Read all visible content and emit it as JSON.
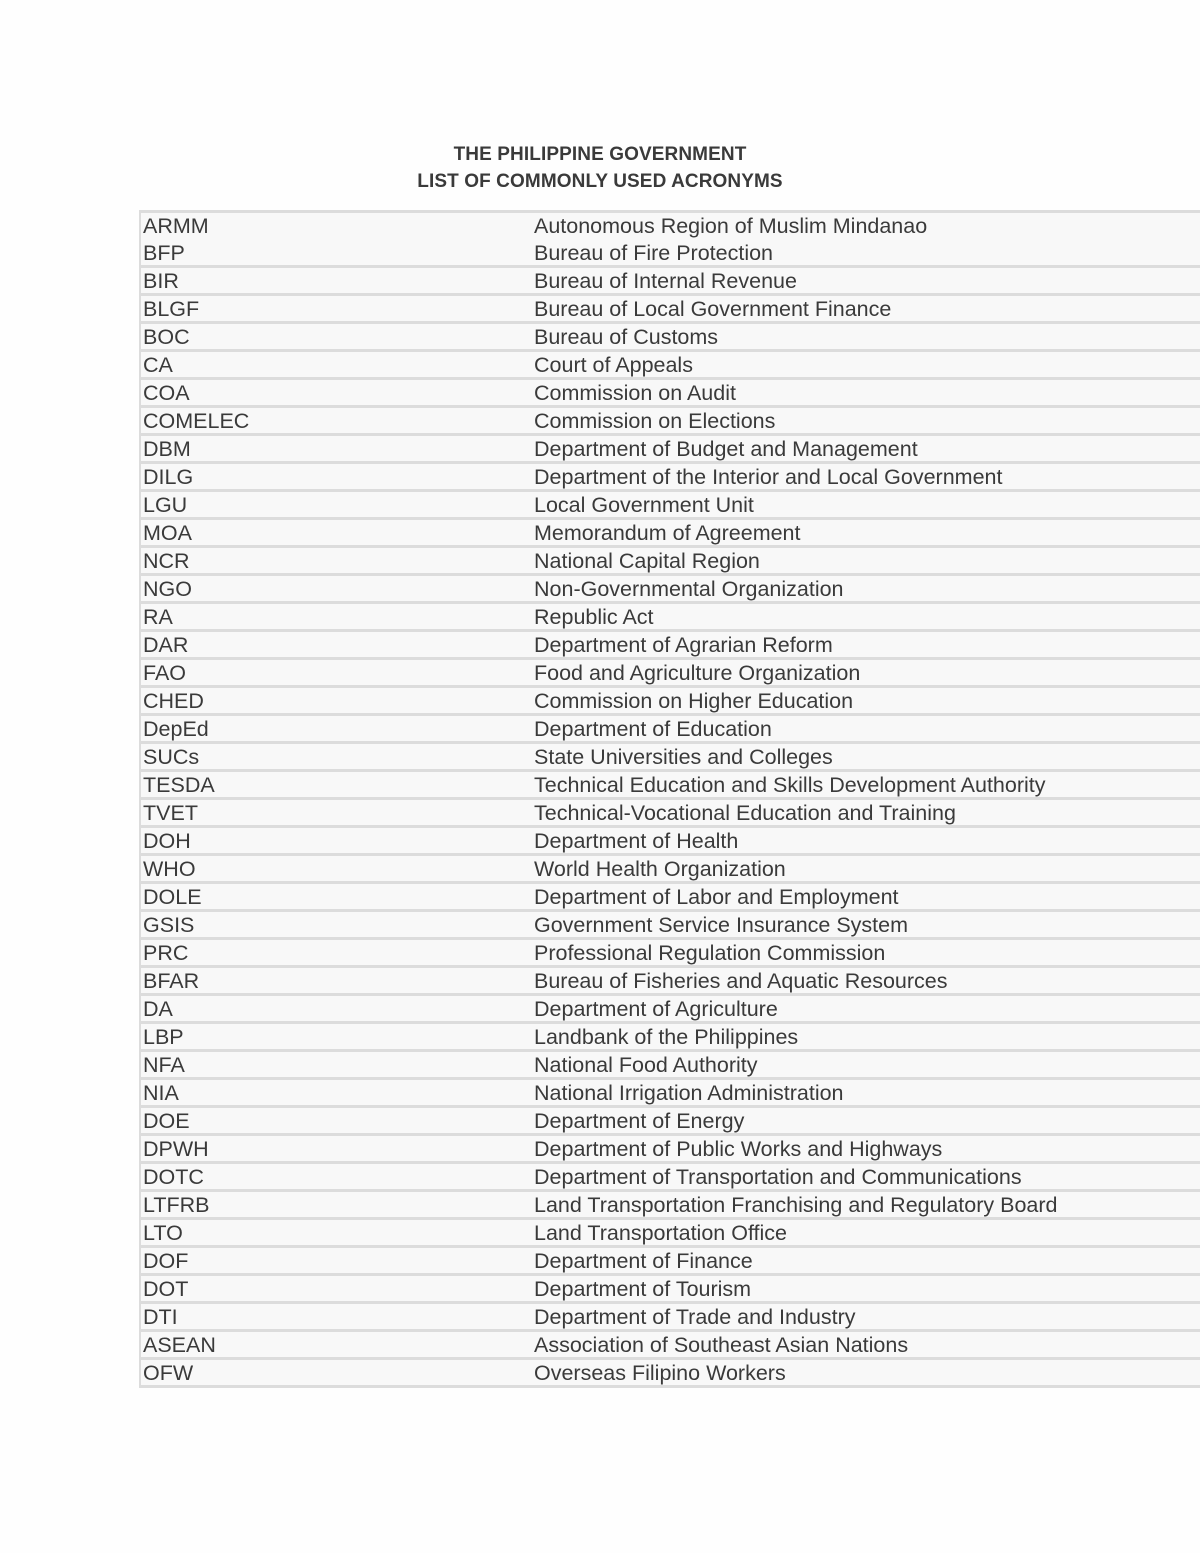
{
  "document": {
    "title_line_1": "THE PHILIPPINE GOVERNMENT",
    "title_line_2": "LIST OF COMMONLY USED ACRONYMS"
  },
  "table": {
    "first_row": {
      "acronyms": [
        "ARMM",
        "BFP"
      ],
      "definitions": [
        "Autonomous Region of Muslim Mindanao",
        "Bureau of Fire Protection"
      ]
    },
    "rows": [
      {
        "acronym": "BIR",
        "definition": "Bureau of Internal Revenue"
      },
      {
        "acronym": "BLGF",
        "definition": "Bureau of Local Government Finance"
      },
      {
        "acronym": "BOC",
        "definition": "Bureau of Customs"
      },
      {
        "acronym": "CA",
        "definition": "Court of Appeals"
      },
      {
        "acronym": "COA",
        "definition": "Commission on Audit"
      },
      {
        "acronym": "COMELEC",
        "definition": "Commission on Elections"
      },
      {
        "acronym": "DBM",
        "definition": "Department of Budget and Management"
      },
      {
        "acronym": "DILG",
        "definition": "Department of the Interior and Local Government"
      },
      {
        "acronym": "LGU",
        "definition": "Local Government Unit"
      },
      {
        "acronym": "MOA",
        "definition": "Memorandum of Agreement"
      },
      {
        "acronym": "NCR",
        "definition": "National Capital Region"
      },
      {
        "acronym": "NGO",
        "definition": "Non-Governmental Organization"
      },
      {
        "acronym": "RA",
        "definition": "Republic Act"
      },
      {
        "acronym": "DAR",
        "definition": "Department of Agrarian Reform"
      },
      {
        "acronym": "FAO",
        "definition": "Food and Agriculture Organization"
      },
      {
        "acronym": "CHED",
        "definition": "Commission on Higher Education"
      },
      {
        "acronym": "DepEd",
        "definition": "Department of Education"
      },
      {
        "acronym": "SUCs",
        "definition": "State Universities and Colleges"
      },
      {
        "acronym": "TESDA",
        "definition": "Technical Education and Skills Development Authority"
      },
      {
        "acronym": "TVET",
        "definition": "Technical-Vocational Education and Training"
      },
      {
        "acronym": "DOH",
        "definition": "Department of Health"
      },
      {
        "acronym": "WHO",
        "definition": "World Health Organization"
      },
      {
        "acronym": "DOLE",
        "definition": "Department of Labor and Employment"
      },
      {
        "acronym": "GSIS",
        "definition": "Government Service Insurance System"
      },
      {
        "acronym": "PRC",
        "definition": "Professional Regulation Commission"
      },
      {
        "acronym": "BFAR",
        "definition": "Bureau of Fisheries and Aquatic Resources"
      },
      {
        "acronym": "DA",
        "definition": "Department of Agriculture"
      },
      {
        "acronym": "LBP",
        "definition": "Landbank of the Philippines"
      },
      {
        "acronym": "NFA",
        "definition": "National Food Authority"
      },
      {
        "acronym": "NIA",
        "definition": "National Irrigation Administration"
      },
      {
        "acronym": "DOE",
        "definition": "Department of Energy"
      },
      {
        "acronym": "DPWH",
        "definition": "Department of Public Works and Highways"
      },
      {
        "acronym": "DOTC",
        "definition": "Department of Transportation and Communications"
      },
      {
        "acronym": "LTFRB",
        "definition": "Land Transportation Franchising and Regulatory Board"
      },
      {
        "acronym": "LTO",
        "definition": "Land Transportation Office"
      },
      {
        "acronym": "DOF",
        "definition": "Department of Finance"
      },
      {
        "acronym": "DOT",
        "definition": "Department of Tourism"
      },
      {
        "acronym": "DTI",
        "definition": "Department of Trade and Industry"
      },
      {
        "acronym": "ASEAN",
        "definition": "Association of Southeast Asian Nations"
      },
      {
        "acronym": "OFW",
        "definition": "Overseas Filipino Workers"
      }
    ]
  }
}
